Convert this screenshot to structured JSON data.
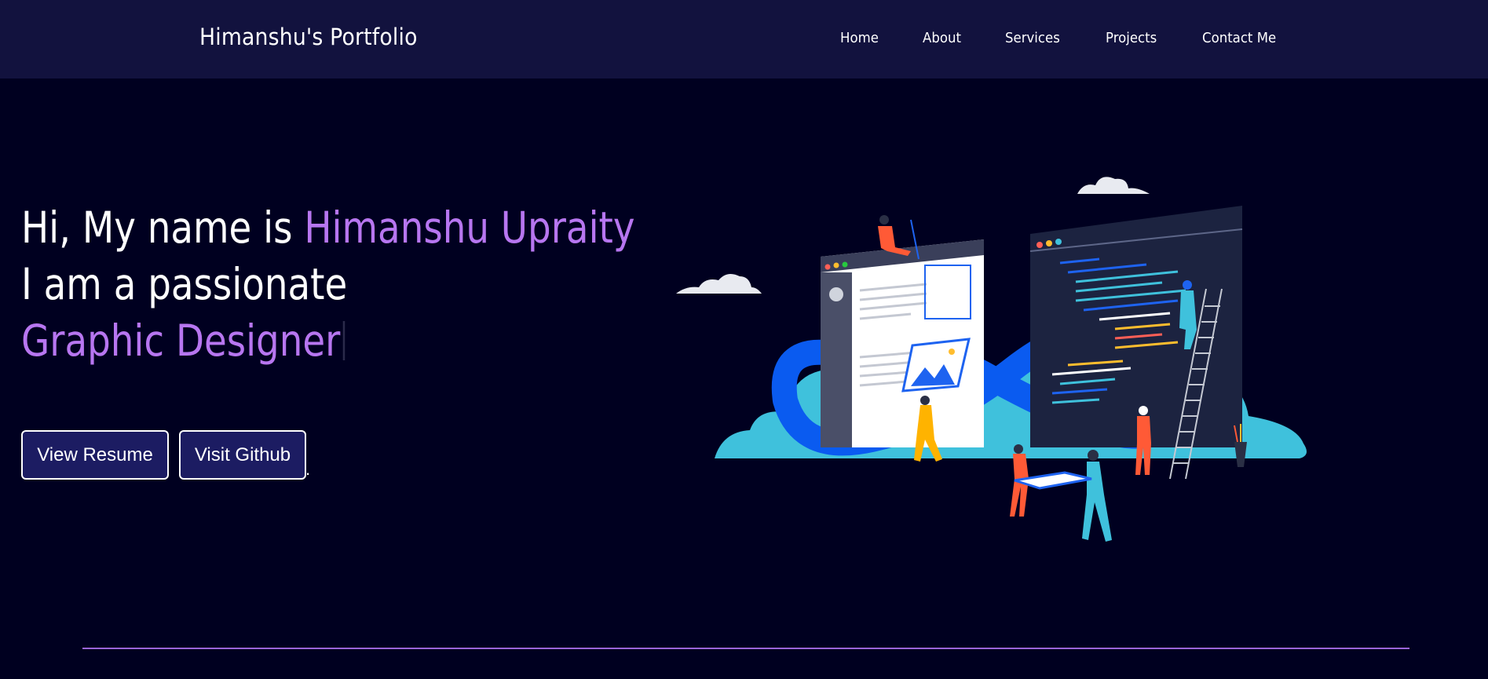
{
  "header": {
    "brand": "Himanshu's Portfolio",
    "nav": [
      "Home",
      "About",
      "Services",
      "Projects",
      "Contact Me"
    ]
  },
  "hero": {
    "line1_prefix": "Hi, My name is ",
    "name": "Himanshu Upraity",
    "line2": "I am a passionate",
    "role": "Graphic Designer",
    "buttons": {
      "resume": "View Resume",
      "github": "Visit Github"
    },
    "trailing_dot": "."
  },
  "colors": {
    "background": "#000020",
    "navbar": "#12123e",
    "accent": "#b776f0",
    "button": "#1c1c62",
    "divider": "#9a64d8"
  },
  "illustration": "developer-team-illustration"
}
